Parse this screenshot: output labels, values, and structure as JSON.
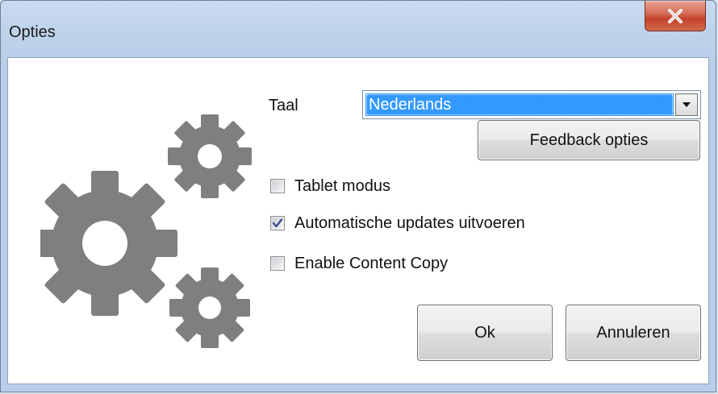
{
  "window": {
    "title": "Opties",
    "close_icon": "close-x-icon"
  },
  "illustration": {
    "icon": "gears-icon",
    "color": "#7f7f7f"
  },
  "language": {
    "label": "Taal",
    "selected": "Nederlands",
    "dropdown_icon": "chevron-down-icon"
  },
  "buttons": {
    "feedback": "Feedback opties",
    "ok": "Ok",
    "cancel": "Annuleren"
  },
  "options": [
    {
      "label": "Tablet modus",
      "checked": false
    },
    {
      "label": "Automatische updates uitvoeren",
      "checked": true
    },
    {
      "label": "Enable Content Copy",
      "checked": false
    }
  ],
  "colors": {
    "selection": "#3399ff",
    "close_button": "#c4432b",
    "titlebar": "#bed2ea"
  }
}
